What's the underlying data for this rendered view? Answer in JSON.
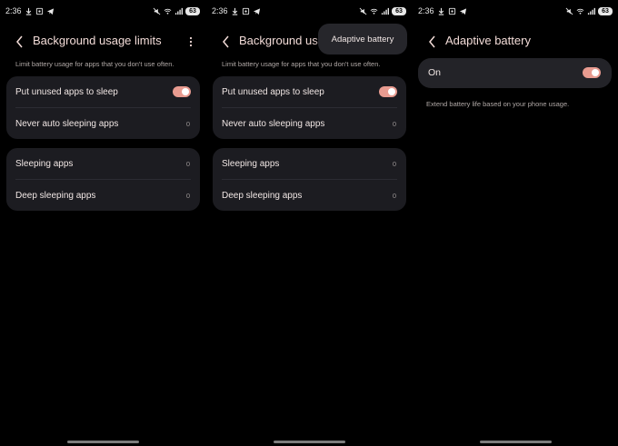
{
  "status_bar": {
    "time": "2:36",
    "battery": "63"
  },
  "screen1": {
    "title": "Background usage limits",
    "subtitle": "Limit battery usage for apps that you don't use often.",
    "card1": {
      "toggle_row_label": "Put unused apps to sleep",
      "toggle_on": true,
      "never_row_label": "Never auto sleeping apps",
      "never_row_count": "0"
    },
    "card2": {
      "sleeping_label": "Sleeping apps",
      "sleeping_count": "0",
      "deep_label": "Deep sleeping apps",
      "deep_count": "0"
    }
  },
  "screen2": {
    "title": "Background usa",
    "subtitle": "Limit battery usage for apps that you don't use often.",
    "menu_item": "Adaptive battery",
    "card1": {
      "toggle_row_label": "Put unused apps to sleep",
      "toggle_on": true,
      "never_row_label": "Never auto sleeping apps",
      "never_row_count": "0"
    },
    "card2": {
      "sleeping_label": "Sleeping apps",
      "sleeping_count": "0",
      "deep_label": "Deep sleeping apps",
      "deep_count": "0"
    }
  },
  "screen3": {
    "title": "Adaptive battery",
    "on_label": "On",
    "toggle_on": true,
    "description": "Extend battery life based on your phone usage."
  },
  "colors": {
    "accent": "#e89b90",
    "card": "#1c1c21",
    "title": "#f3dcd8",
    "background": "#000000"
  }
}
